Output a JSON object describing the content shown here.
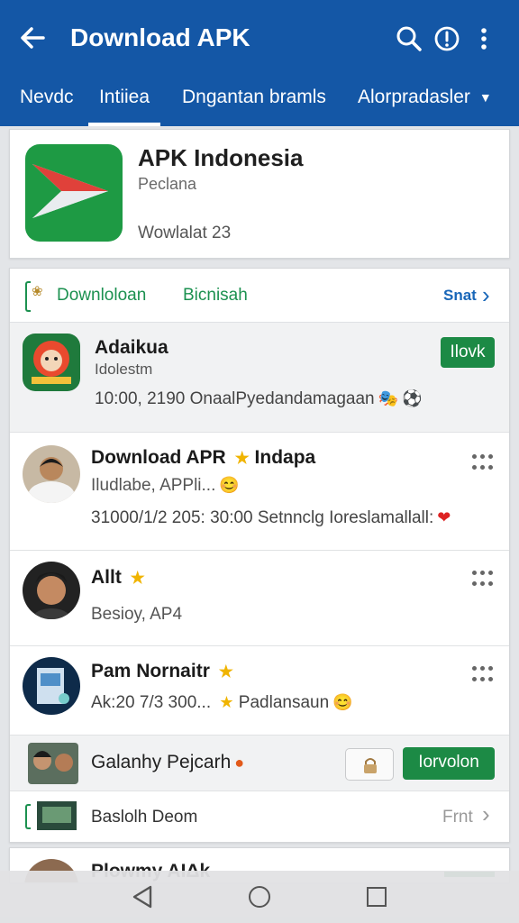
{
  "appbar": {
    "title": "Download APK",
    "back_icon": "arrow-left-icon",
    "actions": [
      "search-icon",
      "info-icon",
      "more-vertical-icon"
    ],
    "color": "#1457a6"
  },
  "tabs": [
    {
      "label": "Nevdc"
    },
    {
      "label": "Intiiea",
      "active": true
    },
    {
      "label": "Dngantan bramls"
    },
    {
      "label": "Alorpradasler"
    }
  ],
  "app": {
    "name": "APK Indonesia",
    "publisher": "Peclana",
    "downloads": "Wowlalat 23"
  },
  "feed": {
    "header": {
      "label1": "Downloloan",
      "label2": "Bicnisah",
      "see_all": "Snat"
    },
    "items": [
      {
        "name": "Adaikua",
        "sub": "Idolestm",
        "meta": "10:00, 2190 OnaalPyedandamagaan",
        "button": "Ilovk"
      },
      {
        "name": "Download APR",
        "name_suffix": "Indapa",
        "sub": "Iludlabe, APPli...",
        "meta": "31000/1/2 205: 30:00 Setnnclg Ioreslamallall:"
      },
      {
        "name": "Allt",
        "sub": "Besioy, AP4"
      },
      {
        "name": "Pam Nornaitr",
        "meta": "Ak:20 7/3 300...",
        "meta_suffix": "Padlansaun"
      },
      {
        "name": "Galanhy Pejcarh",
        "button": "Iorvolon"
      }
    ],
    "footer": {
      "label": "Baslolh Deom",
      "action": "Frnt"
    }
  },
  "peek": {
    "name": "Plowmy AIΔk"
  },
  "accent_green": "#1c8a45",
  "link_blue": "#1866b8"
}
